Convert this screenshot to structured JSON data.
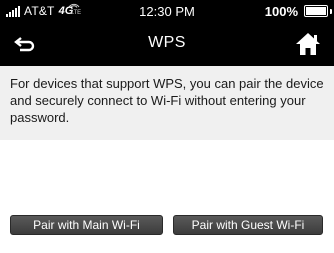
{
  "status_bar": {
    "carrier": "AT&T",
    "network": "4G",
    "network_sub": "LTE",
    "time": "12:30 PM",
    "battery_percent": "100%",
    "battery_level": 1.0
  },
  "header": {
    "title": "WPS",
    "back_icon": "back-arrow-icon",
    "home_icon": "home-icon"
  },
  "description": {
    "text": "For devices that support WPS, you can pair the device and securely connect to Wi-Fi without entering your password."
  },
  "actions": {
    "pair_main_label": "Pair with Main Wi-Fi",
    "pair_guest_label": "Pair with Guest Wi-Fi"
  },
  "colors": {
    "header_bg": "#000000",
    "description_bg": "#f0f0f0",
    "button_bg": "#4a4a4a"
  }
}
